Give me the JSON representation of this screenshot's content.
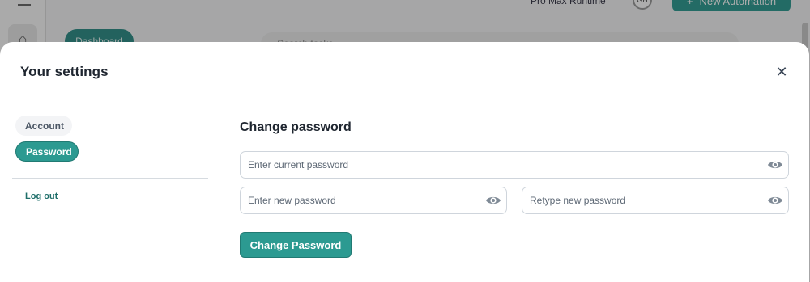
{
  "background": {
    "dashboard_label": "Dashboard",
    "search_placeholder": "Search tasks",
    "runtime_label": "Pro Max Runtime",
    "avatar_initials": "GH",
    "new_automation_label": "New Automation",
    "home_icon": "home-icon",
    "menu_icon": "menu-icon"
  },
  "modal": {
    "title": "Your settings",
    "close_icon": "close-icon",
    "sidebar": {
      "items": [
        {
          "label": "Account",
          "active": false
        },
        {
          "label": "Password",
          "active": true
        }
      ],
      "logout_label": "Log out"
    },
    "password": {
      "heading": "Change password",
      "current_placeholder": "Enter current password",
      "new_placeholder": "Enter new password",
      "retype_placeholder": "Retype new password",
      "eye_icon": "eye-icon",
      "submit_label": "Change Password"
    }
  },
  "colors": {
    "accent": "#2c9a91",
    "accent_dark": "#217a73",
    "text": "#1f2630"
  }
}
